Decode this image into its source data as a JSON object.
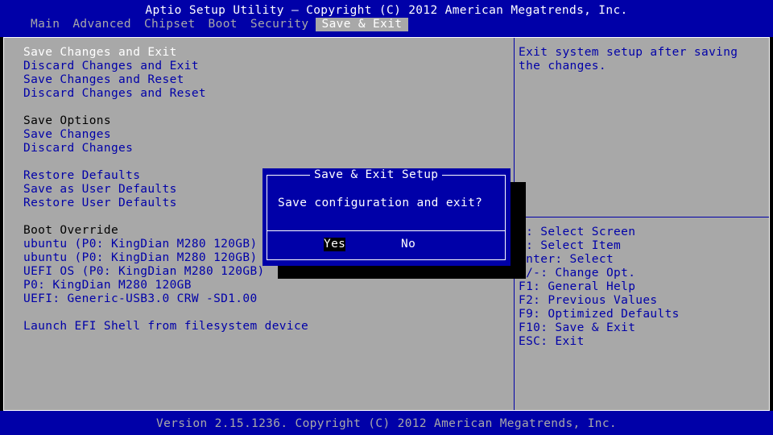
{
  "header": {
    "title": "Aptio Setup Utility – Copyright (C) 2012 American Megatrends, Inc.",
    "tabs": [
      "Main",
      "Advanced",
      "Chipset",
      "Boot",
      "Security",
      "Save & Exit"
    ],
    "active_tab": "Save & Exit"
  },
  "menu": {
    "save_changes_and_exit": "Save Changes and Exit",
    "discard_changes_and_exit": "Discard Changes and Exit",
    "save_changes_and_reset": "Save Changes and Reset",
    "discard_changes_and_reset": "Discard Changes and Reset",
    "save_options_heading": "Save Options",
    "save_changes": "Save Changes",
    "discard_changes": "Discard Changes",
    "restore_defaults": "Restore Defaults",
    "save_as_user_defaults": "Save as User Defaults",
    "restore_user_defaults": "Restore User Defaults",
    "boot_override_heading": "Boot Override",
    "boot_items": [
      "ubuntu (P0: KingDian M280 120GB)",
      "ubuntu (P0: KingDian M280 120GB)",
      "UEFI OS (P0: KingDian M280 120GB)",
      "P0: KingDian M280 120GB",
      "UEFI: Generic-USB3.0 CRW -SD1.00"
    ],
    "launch_efi_shell": "Launch EFI Shell from filesystem device"
  },
  "help": {
    "description_line1": "Exit system setup after saving",
    "description_line2": "the changes.",
    "keys": [
      "↔: Select Screen",
      "↕: Select Item",
      "Enter: Select",
      "+/-: Change Opt.",
      "F1: General Help",
      "F2: Previous Values",
      "F9: Optimized Defaults",
      "F10: Save & Exit",
      "ESC: Exit"
    ]
  },
  "dialog": {
    "title": "Save & Exit Setup",
    "message": "Save configuration and exit?",
    "yes_label": "Yes",
    "no_label": "No",
    "selected": "Yes"
  },
  "footer": {
    "version": "Version 2.15.1236. Copyright (C) 2012 American Megatrends, Inc."
  },
  "colors": {
    "bios_blue": "#0000a8",
    "bios_gray": "#a8a8a8",
    "white": "#ffffff",
    "black": "#000000"
  }
}
